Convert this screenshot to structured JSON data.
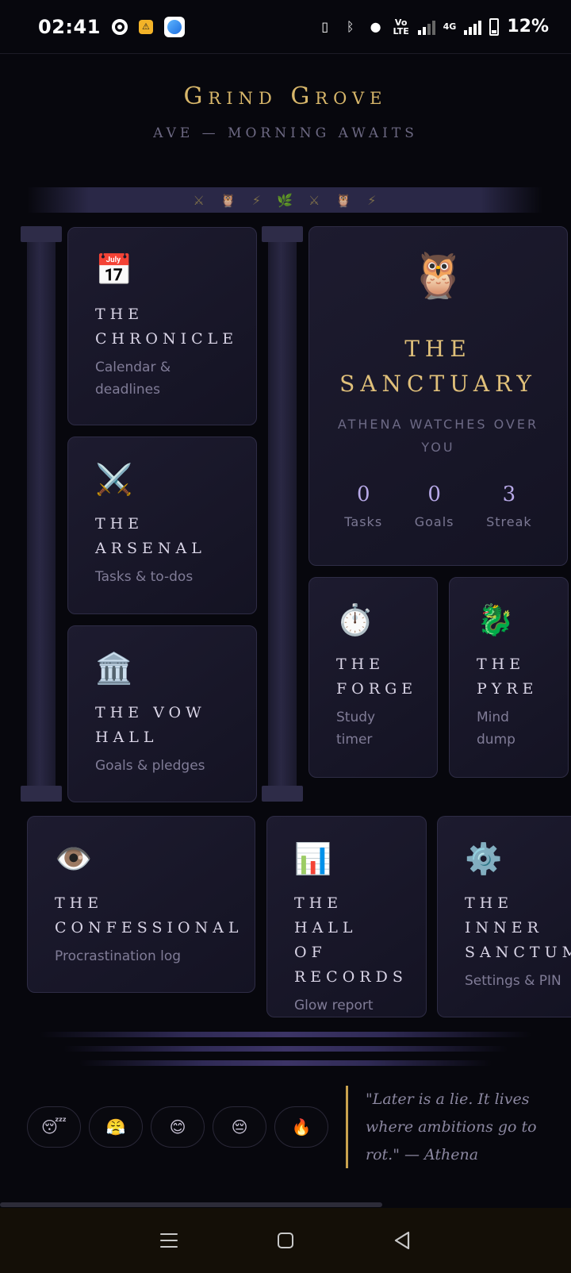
{
  "status": {
    "time": "02:41",
    "network_label": "4G",
    "volte_label": "Vo LTE",
    "battery": "12%"
  },
  "header": {
    "title": "Grind Grove",
    "subtitle": "AVE — MORNING AWAITS"
  },
  "ornaments": [
    "⚔",
    "🦉",
    "⚡",
    "🌿",
    "⚔",
    "🦉",
    "⚡"
  ],
  "cards": {
    "chronicle": {
      "icon": "📅",
      "title": "The Chronicle",
      "desc": "Calendar & deadlines"
    },
    "arsenal": {
      "icon": "⚔️",
      "title": "The Arsenal",
      "desc": "Tasks & to-dos"
    },
    "vow_hall": {
      "icon": "🏛️",
      "title": "The Vow Hall",
      "desc": "Goals & pledges"
    },
    "sanctuary": {
      "icon": "🦉",
      "title": "The Sanctuary",
      "desc": "Athena watches over you",
      "stats": [
        {
          "value": "0",
          "label": "Tasks"
        },
        {
          "value": "0",
          "label": "Goals"
        },
        {
          "value": "3",
          "label": "Streak"
        }
      ]
    },
    "forge": {
      "icon": "⏱️",
      "title": "The Forge",
      "desc": "Study timer"
    },
    "pyre": {
      "icon": "🐉",
      "title": "The Pyre",
      "desc": "Mind dump"
    },
    "confessional": {
      "icon": "👁️",
      "title": "The Confessional",
      "desc": "Procrastination log"
    },
    "records": {
      "icon": "📊",
      "title": "The Hall of Records",
      "desc": "Glow report"
    },
    "inner_sanctum": {
      "icon": "⚙️",
      "title": "The Inner Sanctum",
      "desc": "Settings & PIN"
    }
  },
  "moods": [
    "😴",
    "😤",
    "😊",
    "😔",
    "🔥"
  ],
  "quote": {
    "text": "\"Later is a lie. It lives where ambitions go to rot.\"",
    "author": "— Athena"
  },
  "colors": {
    "gold": "#d7b66a",
    "background": "#07070d",
    "card": "#1d1b2f",
    "accent": "#b8a9e8"
  }
}
